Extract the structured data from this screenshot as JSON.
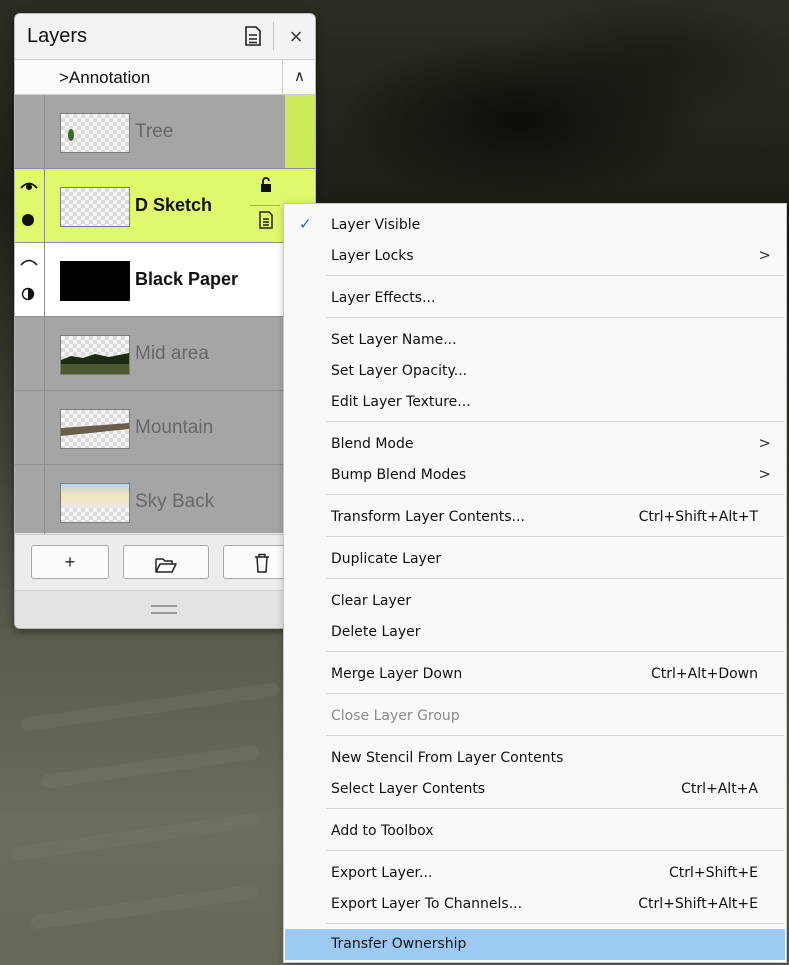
{
  "layers_panel": {
    "title": "Layers",
    "group_label": ">Annotation",
    "collapse_glyph": "∧",
    "close_glyph": "×",
    "layers": [
      {
        "name": "Tree",
        "state": "hidden"
      },
      {
        "name": "D Sketch",
        "state": "selected"
      },
      {
        "name": "Black Paper",
        "state": "visible"
      },
      {
        "name": "Mid area",
        "state": "hidden"
      },
      {
        "name": "Mountain",
        "state": "hidden"
      },
      {
        "name": "Sky Back",
        "state": "hidden"
      }
    ],
    "footer": {
      "add_glyph": "+",
      "icons": [
        "add-layer",
        "folder-icon",
        "trash-icon"
      ]
    },
    "icons": [
      "panel-menu-icon",
      "eye-icon",
      "lock-icon",
      "layer-menu-icon",
      "closed-eye-icon",
      "opacity-icon"
    ]
  },
  "context_menu": {
    "items": [
      {
        "label": "Layer Visible",
        "checked": true
      },
      {
        "label": "Layer Locks",
        "submenu": true
      },
      {
        "label": "Layer Effects..."
      },
      {
        "label": "Set Layer Name..."
      },
      {
        "label": "Set Layer Opacity..."
      },
      {
        "label": "Edit Layer Texture..."
      },
      {
        "label": "Blend Mode",
        "submenu": true
      },
      {
        "label": "Bump Blend Modes",
        "submenu": true
      },
      {
        "label": "Transform Layer Contents...",
        "shortcut": "Ctrl+Shift+Alt+T"
      },
      {
        "label": "Duplicate Layer"
      },
      {
        "label": "Clear Layer"
      },
      {
        "label": "Delete Layer"
      },
      {
        "label": "Merge Layer Down",
        "shortcut": "Ctrl+Alt+Down"
      },
      {
        "label": "Close Layer Group",
        "disabled": true
      },
      {
        "label": "New Stencil From Layer Contents"
      },
      {
        "label": "Select Layer Contents",
        "shortcut": "Ctrl+Alt+A"
      },
      {
        "label": "Add to Toolbox"
      },
      {
        "label": "Export Layer...",
        "shortcut": "Ctrl+Shift+E"
      },
      {
        "label": "Export Layer To Channels...",
        "shortcut": "Ctrl+Shift+Alt+E"
      },
      {
        "label": "Transfer Ownership",
        "highlighted": true
      }
    ],
    "check_glyph": "✓",
    "submenu_glyph": ">"
  },
  "colors": {
    "selected_layer": "#def96b",
    "menu_highlight": "#9ccaf3",
    "panel_bg": "#e6e6e6"
  }
}
